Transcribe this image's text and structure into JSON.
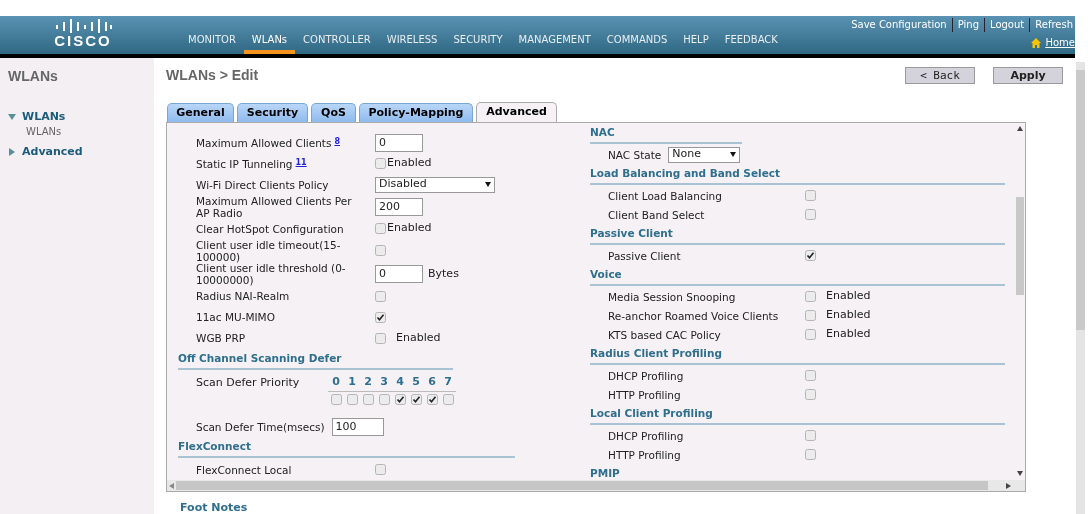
{
  "header": {
    "logo_text": "CISCO",
    "nav": [
      {
        "label": "MONITOR",
        "selected": false
      },
      {
        "label": "WLANs",
        "selected": true
      },
      {
        "label": "CONTROLLER",
        "selected": false
      },
      {
        "label": "WIRELESS",
        "selected": false
      },
      {
        "label": "SECURITY",
        "selected": false
      },
      {
        "label": "MANAGEMENT",
        "selected": false
      },
      {
        "label": "COMMANDS",
        "selected": false
      },
      {
        "label": "HELP",
        "selected": false
      },
      {
        "label": "FEEDBACK",
        "selected": false
      }
    ],
    "top_links": [
      "Save Configuration",
      "Ping",
      "Logout",
      "Refresh"
    ],
    "home_link": "Home"
  },
  "sidebar": {
    "title": "WLANs",
    "items": [
      {
        "label": "WLANs",
        "expanded": true,
        "children": [
          {
            "label": "WLANs"
          }
        ]
      },
      {
        "label": "Advanced",
        "expanded": false
      }
    ]
  },
  "page_title": "WLANs > Edit",
  "buttons": [
    "< Back",
    "Apply"
  ],
  "tabs": [
    {
      "label": "General",
      "selected": false
    },
    {
      "label": "Security",
      "selected": false
    },
    {
      "label": "QoS",
      "selected": false
    },
    {
      "label": "Policy-Mapping",
      "selected": false
    },
    {
      "label": "Advanced",
      "selected": true
    }
  ],
  "left_column": [
    {
      "kind": "input",
      "label": "Maximum Allowed Clients",
      "footnote": "8",
      "value": "0"
    },
    {
      "kind": "checkbox",
      "label": "Static IP Tunneling",
      "footnote": "11",
      "checked": false,
      "text": "Enabled"
    },
    {
      "kind": "select",
      "label": "Wi-Fi Direct Clients Policy",
      "value": "Disabled"
    },
    {
      "kind": "input",
      "label": "Maximum Allowed Clients Per AP Radio",
      "value": "200"
    },
    {
      "kind": "checkbox",
      "label": "Clear HotSpot Configuration",
      "checked": false,
      "text": "Enabled"
    },
    {
      "kind": "checkbox",
      "label": "Client user idle timeout(15-100000)",
      "checked": false
    },
    {
      "kind": "input",
      "label": "Client user idle threshold (0-10000000)",
      "value": "0",
      "suffix": "Bytes"
    },
    {
      "kind": "checkbox",
      "label": "Radius NAI-Realm",
      "checked": false
    },
    {
      "kind": "checkbox",
      "label": "11ac MU-MIMO",
      "checked": true
    },
    {
      "kind": "checkbox",
      "label": "WGB PRP",
      "checked": false,
      "text": "Enabled"
    },
    {
      "kind": "heading",
      "label": "Off Channel Scanning Defer"
    },
    {
      "kind": "priority",
      "label": "Scan Defer Priority",
      "levels": [
        {
          "label": "0",
          "checked": false
        },
        {
          "label": "1",
          "checked": false
        },
        {
          "label": "2",
          "checked": false
        },
        {
          "label": "3",
          "checked": false
        },
        {
          "label": "4",
          "checked": true
        },
        {
          "label": "5",
          "checked": true
        },
        {
          "label": "6",
          "checked": true
        },
        {
          "label": "7",
          "checked": false
        }
      ]
    },
    {
      "kind": "inline_input",
      "label": "Scan Defer Time(msecs)",
      "value": "100"
    },
    {
      "kind": "heading",
      "label": "FlexConnect"
    },
    {
      "kind": "checkbox",
      "label": "FlexConnect Local",
      "checked": false
    }
  ],
  "right_column": [
    {
      "kind": "heading",
      "label": "NAC"
    },
    {
      "kind": "select",
      "label": "NAC State",
      "value": "None"
    },
    {
      "kind": "heading",
      "label": "Load Balancing and Band Select"
    },
    {
      "kind": "checkbox",
      "label": "Client Load Balancing",
      "checked": false
    },
    {
      "kind": "checkbox",
      "label": "Client Band Select",
      "checked": false
    },
    {
      "kind": "heading",
      "label": "Passive Client"
    },
    {
      "kind": "checkbox",
      "label": "Passive Client",
      "checked": true
    },
    {
      "kind": "heading",
      "label": "Voice"
    },
    {
      "kind": "checkbox",
      "label": "Media Session Snooping",
      "checked": false,
      "text": "Enabled"
    },
    {
      "kind": "checkbox",
      "label": "Re-anchor Roamed Voice Clients",
      "checked": false,
      "text": "Enabled"
    },
    {
      "kind": "checkbox",
      "label": "KTS based CAC Policy",
      "checked": false,
      "text": "Enabled"
    },
    {
      "kind": "heading",
      "label": "Radius Client Profiling"
    },
    {
      "kind": "checkbox",
      "label": "DHCP Profiling",
      "checked": false
    },
    {
      "kind": "checkbox",
      "label": "HTTP Profiling",
      "checked": false
    },
    {
      "kind": "heading",
      "label": "Local Client Profiling"
    },
    {
      "kind": "checkbox",
      "label": "DHCP Profiling",
      "checked": false
    },
    {
      "kind": "checkbox",
      "label": "HTTP Profiling",
      "checked": false
    },
    {
      "kind": "heading",
      "label": "PMIP"
    }
  ],
  "footer": "Foot Notes"
}
